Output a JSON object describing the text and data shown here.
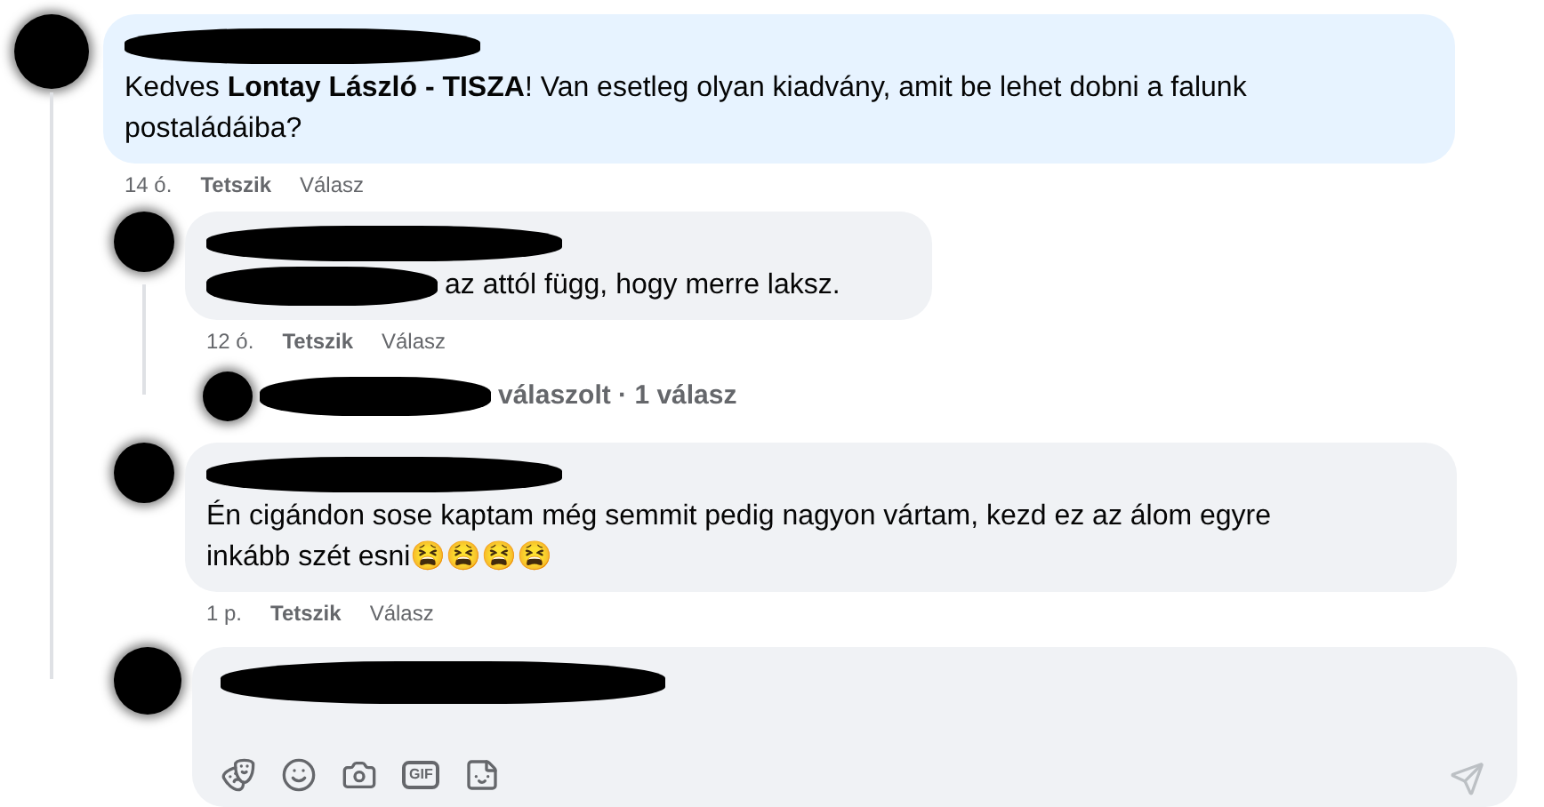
{
  "comments": [
    {
      "text": "Kedves **Lontay László - TISZA**! Van esetleg olyan kiadvány, amit be lehet dobni a falunk postaládáiba?",
      "time": "14 ó.",
      "like": "Tetszik",
      "reply": "Válasz",
      "replies": [
        {
          "text": "az attól függ, hogy merre laksz.",
          "time": "12 ó.",
          "like": "Tetszik",
          "reply": "Válasz",
          "reply_summary": "válaszolt · 1 válasz"
        },
        {
          "text": "Én cigándon sose kaptam még semmit pedig nagyon vártam, kezd ez az álom egyre inkább szét esni😫😫😫😫",
          "time": "1 p.",
          "like": "Tetszik",
          "reply": "Válasz"
        }
      ]
    }
  ],
  "composer": {
    "gif_label": "GIF",
    "send_disabled": true
  }
}
